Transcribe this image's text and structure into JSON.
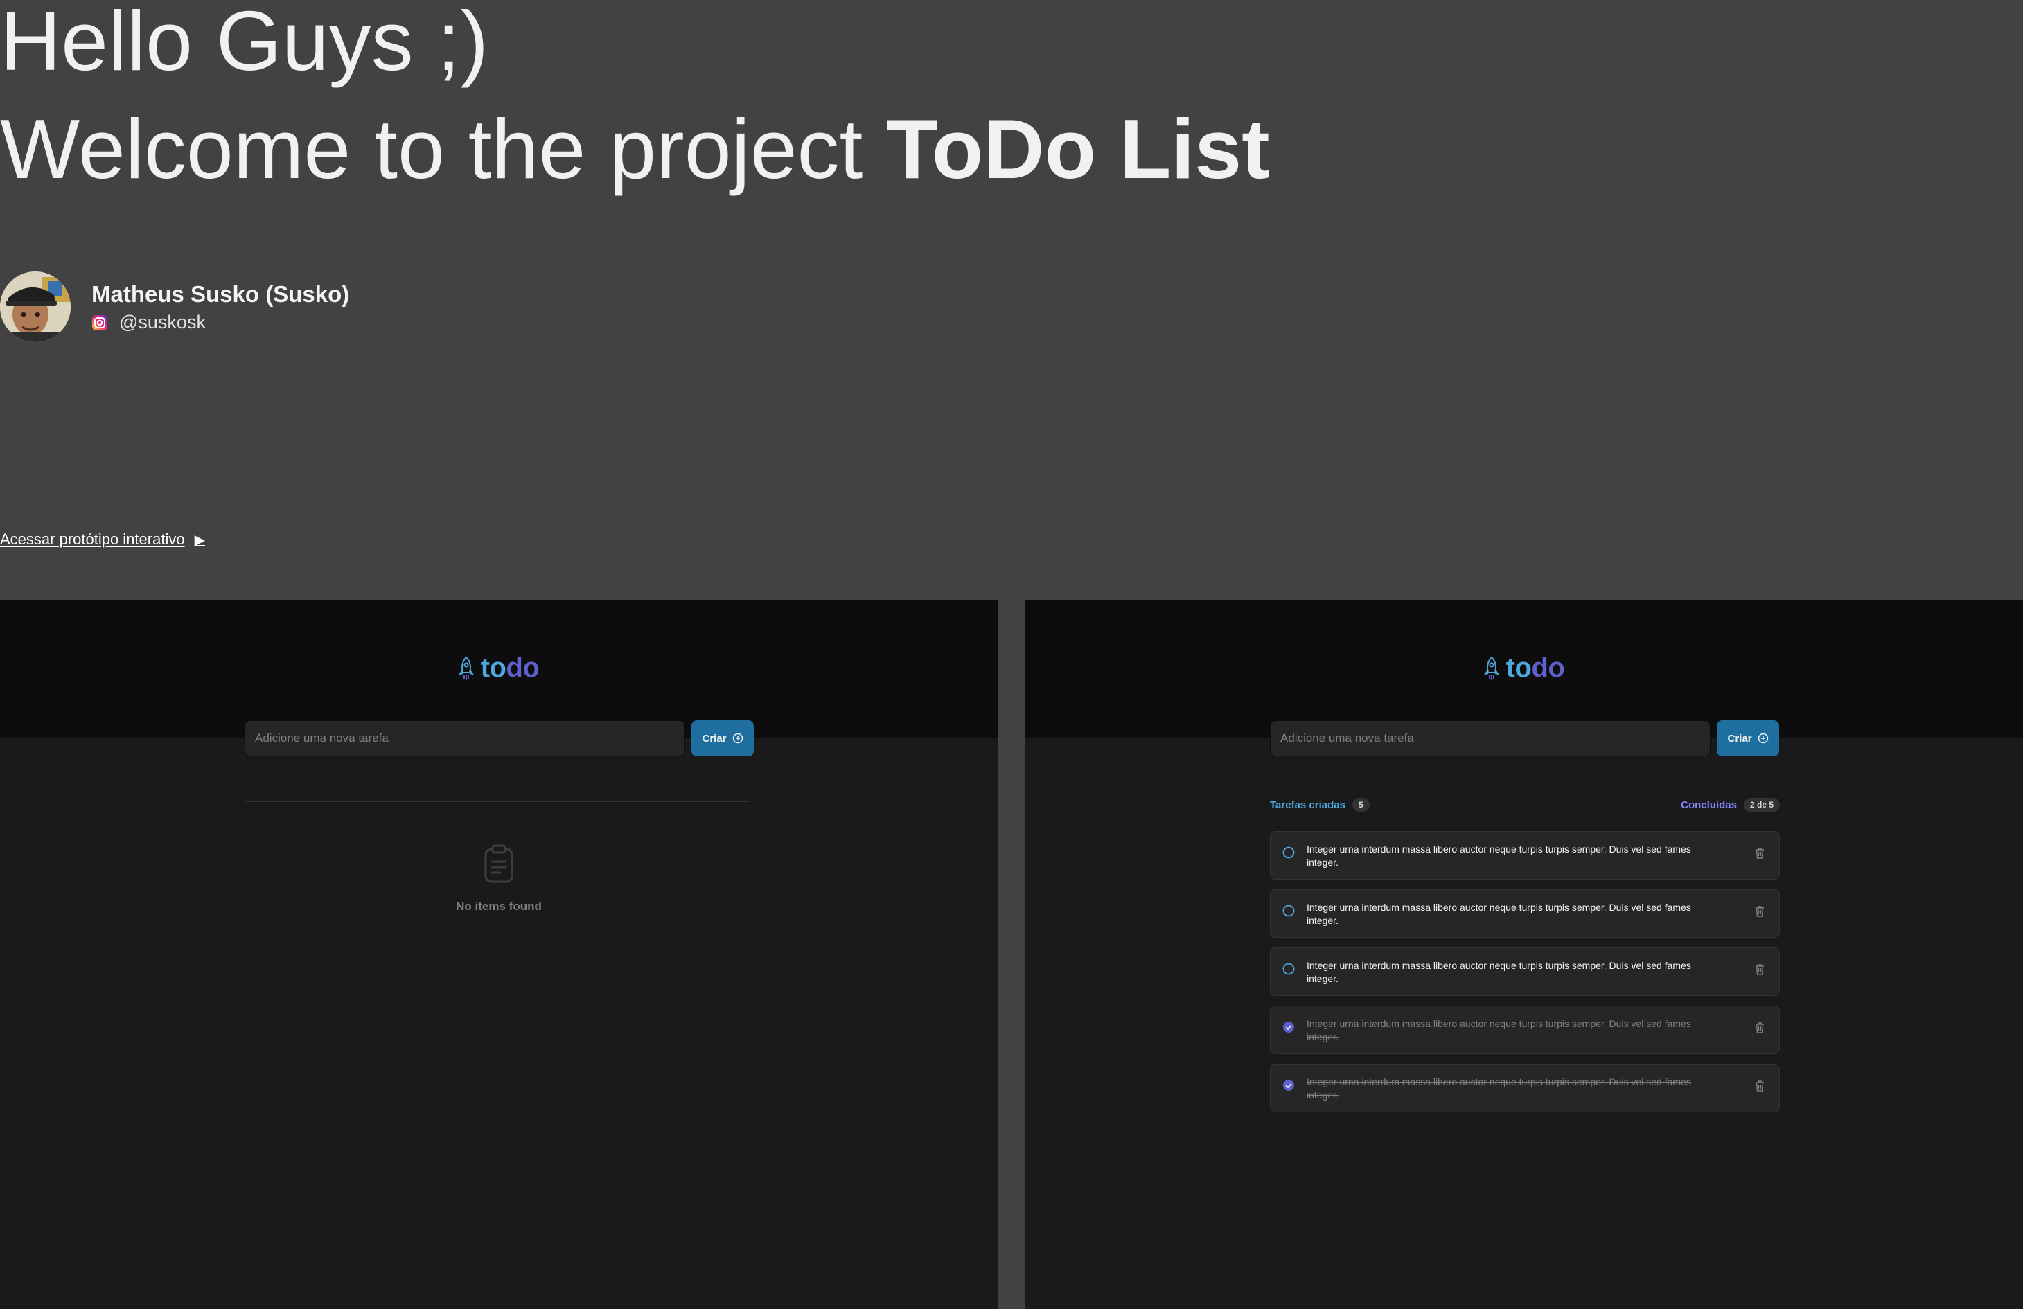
{
  "intro": {
    "greeting": "Hello Guys ;)",
    "welcome_prefix": "Welcome to the project ",
    "project_name": "ToDo List"
  },
  "author": {
    "name": "Matheus Susko (Susko)",
    "handle": "@suskosk",
    "icon": "instagram-icon"
  },
  "prototype_link": {
    "label": "Acessar protótipo interativo",
    "icon": "play-arrow-icon"
  },
  "app": {
    "logo": {
      "part1": "to",
      "part2": "do",
      "icon": "rocket-icon"
    },
    "input_placeholder": "Adicione uma nova tarefa",
    "create_label": "Criar",
    "empty_state": {
      "text": "No items found",
      "icon": "clipboard-icon"
    },
    "counters": {
      "created_label": "Tarefas criadas",
      "created_count": "5",
      "done_label": "Concluídas",
      "done_count": "2 de 5"
    },
    "tasks": [
      {
        "text": "Integer urna interdum massa libero auctor neque turpis turpis semper. Duis vel sed fames integer.",
        "done": false
      },
      {
        "text": "Integer urna interdum massa libero auctor neque turpis turpis semper. Duis vel sed fames integer.",
        "done": false
      },
      {
        "text": "Integer urna interdum massa libero auctor neque turpis turpis semper. Duis vel sed fames integer.",
        "done": false
      },
      {
        "text": "Integer urna interdum massa libero auctor neque turpis turpis semper. Duis vel sed fames integer.",
        "done": true
      },
      {
        "text": "Integer urna interdum massa libero auctor neque turpis turpis semper. Duis vel sed fames integer.",
        "done": true
      }
    ]
  },
  "colors": {
    "page_bg": "#424242",
    "panel_bg": "#1a1a1a",
    "header_bg": "#0d0d0d",
    "blue": "#4ea8de",
    "purple": "#5e60ce",
    "button": "#1e6f9f"
  }
}
